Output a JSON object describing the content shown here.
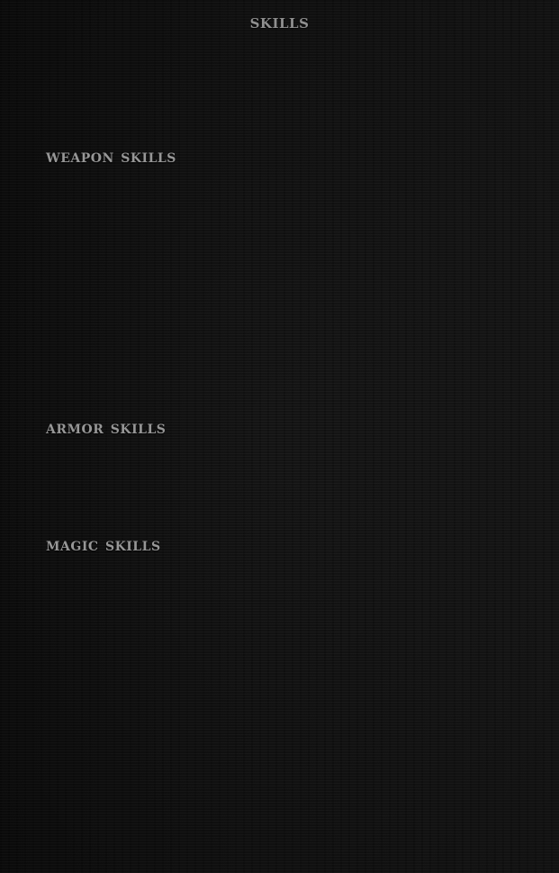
{
  "page": {
    "title": "skills"
  },
  "sections": [
    {
      "id": "weapon",
      "heading": "weapon skills"
    },
    {
      "id": "armor",
      "heading": "armor skills"
    },
    {
      "id": "magic",
      "heading": "magic skills"
    }
  ],
  "colors": {
    "background": "#121212",
    "heading_text": "#8f8f8f"
  }
}
